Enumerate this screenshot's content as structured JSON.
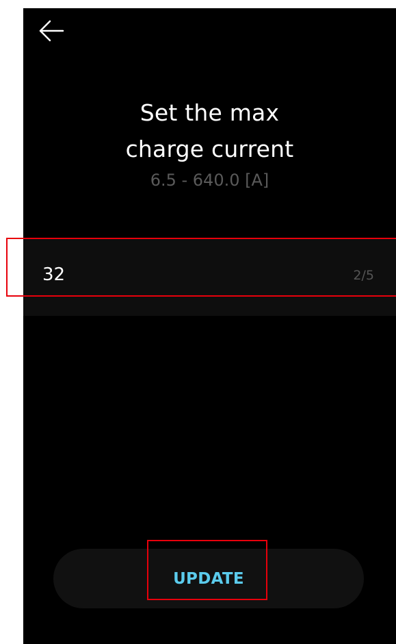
{
  "header": {
    "back_icon": "arrow-left-icon"
  },
  "title": {
    "line1": "Set the max",
    "line2": "charge current"
  },
  "range_text": "6.5 - 640.0 [A]",
  "input": {
    "value": "32",
    "counter": "2/5"
  },
  "update_button": {
    "label": "UPDATE"
  },
  "colors": {
    "background": "#000000",
    "accent": "#5bcbec",
    "highlight": "#e8000b"
  }
}
